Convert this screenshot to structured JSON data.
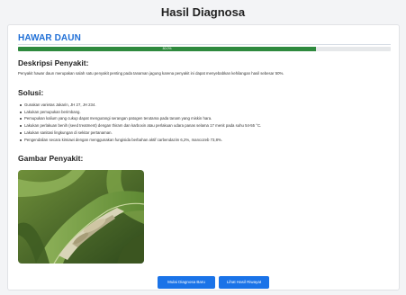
{
  "page": {
    "title": "Hasil Diagnosa"
  },
  "result": {
    "disease_name": "HAWAR DAUN",
    "confidence_percent": 80,
    "confidence_label": "80.0%",
    "accent_color": "#1f6fd6",
    "bar_color": "#2f8a3e"
  },
  "description": {
    "heading": "Deskripsi Penyakit:",
    "text": "Penyakit hawar daun merupakan salah satu penyakit penting pada tanaman jagung karena penyakit ini dapat menyebabkan kehilangan hasil sebesar 50%."
  },
  "solution": {
    "heading": "Solusi:",
    "items": [
      "Gunakan varietas Jakarin, JH 27, JH 234.",
      "Lakukan pemupukan berimbang.",
      "Pemupukan kalium yang cukup dapat mengurangi serangan patogen terutama pada tanam yang miskin hara.",
      "Lakukan perlakuan benih (seed treatment) dengan thiram dan karboxin atau perlakuan udara panas selama 17 menit pada suhu 54-55 °C.",
      "Lakukan sanitasi lingkungan di sekitar pertanaman.",
      "Pengendalian secara kimiawi dengan menggunakan fungisida berbahan aktif carbendazim 6,2%, mancozeb 73,8%."
    ]
  },
  "image_section": {
    "heading": "Gambar Penyakit:"
  },
  "actions": {
    "start_diagnosis": "Mulai Diagnosa Baru",
    "view_history": "Lihat Hasil Riwayat",
    "button_color": "#1a73e8"
  }
}
